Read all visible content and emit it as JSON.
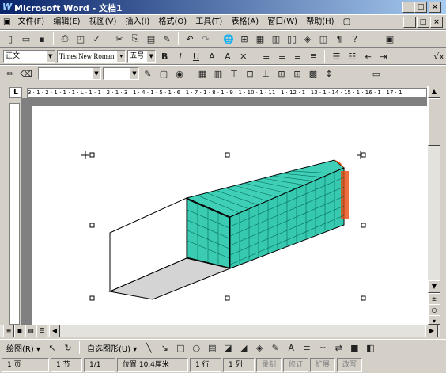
{
  "window": {
    "title": "Microsoft Word - 文档1",
    "app_icon": "W"
  },
  "menu": {
    "items": [
      "文件(F)",
      "编辑(E)",
      "视图(V)",
      "插入(I)",
      "格式(O)",
      "工具(T)",
      "表格(A)",
      "窗口(W)",
      "帮助(H)"
    ]
  },
  "format": {
    "style": "正文",
    "font": "Times New Roman",
    "size": "五号"
  },
  "ruler": {
    "h_text": "3 · 1 · 2 · 1 · 1 · 1 · L · 1 · 1 · 2 · 1 · 3 · 1 · 4 · 1 · 5 · 1 · 6 · 1 · 7 · 1 · 8 · 1 · 9 · 1 · 10 · 1 · 11 · 1 · 12 · 1 · 13 · 1 · 14 · 15 · 1 · 16 · 1 · 17 · 1"
  },
  "draw": {
    "draw_label": "绘图(R) ▾",
    "autoshape_label": "自选图形(U) ▾"
  },
  "status": {
    "page": "1 页",
    "section": "1 节",
    "pages": "1/1",
    "position": "位置 10.4厘米",
    "line": "1 行",
    "col": "1 列",
    "rec": "录制",
    "trk": "修订",
    "ext": "扩展",
    "ovr": "改写"
  }
}
